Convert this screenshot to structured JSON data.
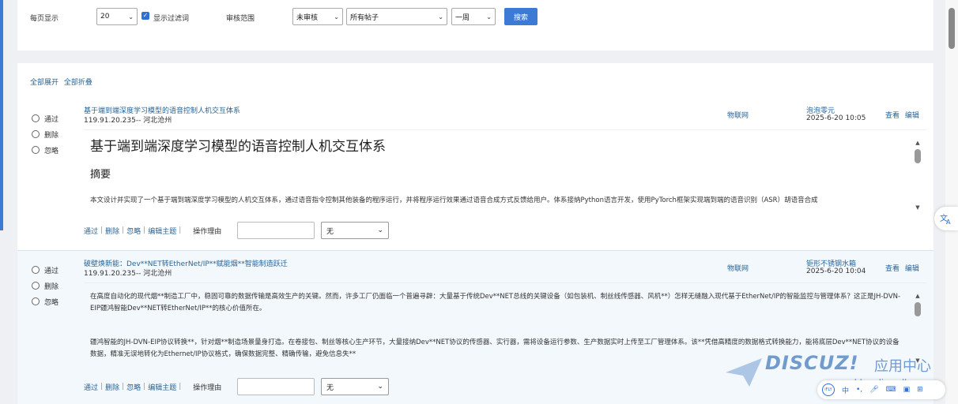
{
  "filters": {
    "per_page_label": "每页显示",
    "per_page_value": "20",
    "show_filtered_label": "显示过滤词",
    "review_scope_label": "审核范围",
    "status_value": "未审核",
    "posts_value": "所有帖子",
    "period_value": "一周",
    "search_label": "搜索"
  },
  "list": {
    "expand_all": "全部展开",
    "collapse_all": "全部折叠",
    "radio_pass": "通过",
    "radio_delete": "删除",
    "radio_ignore": "忽略",
    "view": "查看",
    "edit": "编辑",
    "op_pass": "通过",
    "op_delete": "删除",
    "op_ignore": "忽略",
    "op_edit_topic": "编辑主题",
    "op_sep": "|",
    "op_reason_label": "操作理由",
    "op_reason_option": "无",
    "posts": [
      {
        "title": "基于端到端深度学习模型的语音控制人机交互体系",
        "ip": "119.91.20.235-- 河北沧州",
        "forum": "物联网",
        "author": "泡泡零元",
        "date": "2025-6-20 10:05",
        "content_h1": "基于端到端深度学习模型的语音控制人机交互体系",
        "content_h2": "摘要",
        "content_p": "本文设计并实现了一个基于端到端深度学习模型的人机交互体系，通过语音指令控制其他装备的程序运行，并将程序运行效果通过语音合成方式反馈给用户。体系接纳Python语言开发，使用PyTorch框架实现端到端的语音识别（ASR）胡语音合成"
      },
      {
        "title": "破壁焕新能：Dev**NET转EtherNet/IP**赋能烟**智能制造跃迁",
        "ip": "119.91.20.235-- 河北沧州",
        "forum": "物联网",
        "author": "钜形不锈钢水箱",
        "date": "2025-6-20 10:04",
        "content_p1": "在高度自动化的现代烟**制造工厂中，稳固可靠的数据传输是高效生产的关键。然而，许多工厂仍面临一个普遍寻辟：大量基于传统Dev**NET总线的关键设备（如包装机、制丝线传感器、风机**）怎样无缝融入现代基于EtherNet/IP的智能监控与管理体系？这正是JH-DVN-EIP疆鸿智能Dev**NET转EtherNet/IP**的核心价值所在。",
        "content_p2": "疆鸿智能的JH-DVN-EIP协议转换**，针对烟**制造场景量身打造。在卷接包、制丝等核心生产环节，大量接纳Dev**NET协议的传感器、实行器，需将设备运行参数、生产数据实时上传至工厂管理体系。该**凭借高精度的数据格式转换能力，能将底层Dev**NET协议的设备数据，精准无误地转化为Ethernet/IP协议格式，确保数据完整、精确传输，避免信息失**"
      }
    ]
  },
  "watermark": {
    "logo": "DISCUZ!",
    "cn": "应用中心",
    "url": "addon.dismall.com"
  },
  "ifly": {
    "logo": "iFLY",
    "zh": "中"
  },
  "colors": {
    "accent": "#3d7ad6",
    "link": "#2a6496"
  }
}
